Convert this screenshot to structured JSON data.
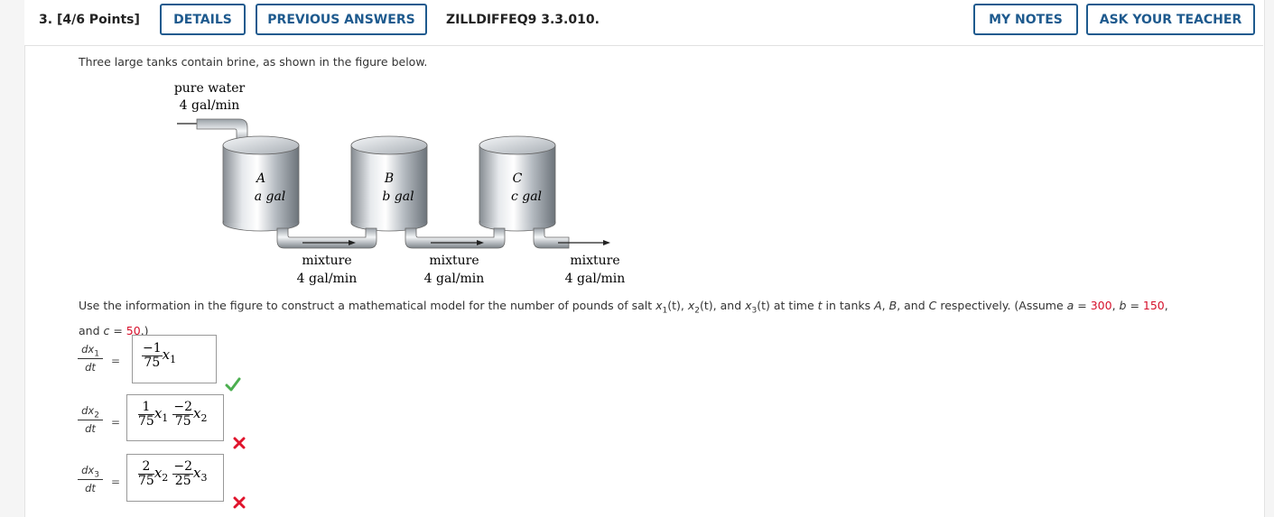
{
  "header": {
    "question_number": "3.",
    "points": "[4/6 Points]",
    "details_label": "DETAILS",
    "previous_answers_label": "PREVIOUS ANSWERS",
    "problem_code": "ZILLDIFFEQ9 3.3.010.",
    "my_notes_label": "MY NOTES",
    "ask_teacher_label": "ASK YOUR TEACHER"
  },
  "intro_text": "Three large tanks contain brine, as shown in the figure below.",
  "figure": {
    "inflow_label": "pure water",
    "inflow_rate": "4 gal/min",
    "tanks": [
      {
        "letter": "A",
        "volume": "a gal"
      },
      {
        "letter": "B",
        "volume": "b gal"
      },
      {
        "letter": "C",
        "volume": "c gal"
      }
    ],
    "flows": [
      {
        "label": "mixture",
        "rate": "4 gal/min"
      },
      {
        "label": "mixture",
        "rate": "4 gal/min"
      },
      {
        "label": "mixture",
        "rate": "4 gal/min"
      }
    ]
  },
  "prompt": {
    "p1": "Use the information in the figure to construct a mathematical model for the number of pounds of salt ",
    "x": "x",
    "p_t_comma": "(t), ",
    "p_t_and": "(t), and ",
    "p_t_time": "(t) at time ",
    "t": "t",
    "p_tanks": " in tanks ",
    "A": "A",
    "B": "B",
    "C": "C",
    "p_resp": " respectively. (Assume ",
    "a": "a",
    "b": "b",
    "c": "c",
    "eq": " = ",
    "a_val": "300",
    "b_val": "150",
    "c_val": "50",
    "and_text": "and ",
    "close": ".)"
  },
  "equations": [
    {
      "lhs_num": "dx",
      "lhs_sub": "1",
      "lhs_den": "dt",
      "eq": "=",
      "terms": [
        {
          "num": "−1",
          "den": "75",
          "var": "x",
          "sub": "1"
        }
      ],
      "status": "correct"
    },
    {
      "lhs_num": "dx",
      "lhs_sub": "2",
      "lhs_den": "dt",
      "eq": "=",
      "terms": [
        {
          "num": "1",
          "den": "75",
          "var": "x",
          "sub": "1"
        },
        {
          "num": "−2",
          "den": "75",
          "var": "x",
          "sub": "2"
        }
      ],
      "status": "incorrect"
    },
    {
      "lhs_num": "dx",
      "lhs_sub": "3",
      "lhs_den": "dt",
      "eq": "=",
      "terms": [
        {
          "num": "2",
          "den": "75",
          "var": "x",
          "sub": "2"
        },
        {
          "num": "−2",
          "den": "25",
          "var": "x",
          "sub": "3"
        }
      ],
      "status": "incorrect"
    }
  ],
  "colors": {
    "accent": "#1e5a8e",
    "highlight": "#d6102b",
    "correct": "#4caf50",
    "incorrect": "#e0142c"
  }
}
